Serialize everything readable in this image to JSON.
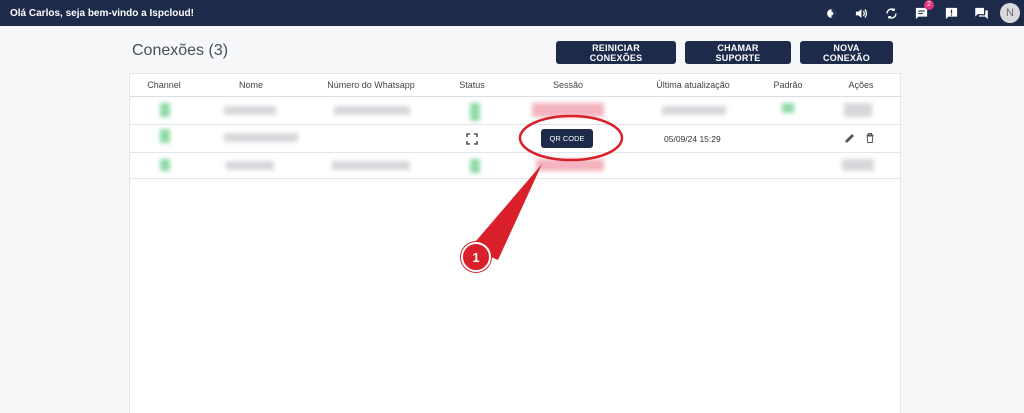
{
  "topbar": {
    "greeting_prefix": "Olá Carlos, seja bem-vindo a ",
    "brand": "Ispcloud!",
    "icons": [
      "brightness-icon",
      "volume-icon",
      "refresh-icon",
      "chat-icon",
      "alert-icon",
      "messages-icon"
    ],
    "chat_badge": "2",
    "avatar_letter": "N"
  },
  "page": {
    "title": "Conexões (3)"
  },
  "toolbar": {
    "restart_label": "REINICIAR CONEXÕES",
    "support_label": "CHAMAR SUPORTE",
    "new_label": "NOVA CONEXÃO"
  },
  "table": {
    "columns": [
      "Channel",
      "Nome",
      "Número do Whatsapp",
      "Status",
      "Sessão",
      "Última atualização",
      "Padrão",
      "Ações"
    ],
    "rows": [
      {
        "session_button": "",
        "updated": ""
      },
      {
        "session_button": "QR CODE",
        "updated": "05/09/24 15:29"
      },
      {
        "session_button": "",
        "updated": ""
      }
    ]
  },
  "annotation": {
    "number": "1"
  },
  "colors": {
    "navy": "#1e2a4a",
    "callout_red": "#d9202a",
    "badge_pink": "#e2327a"
  }
}
